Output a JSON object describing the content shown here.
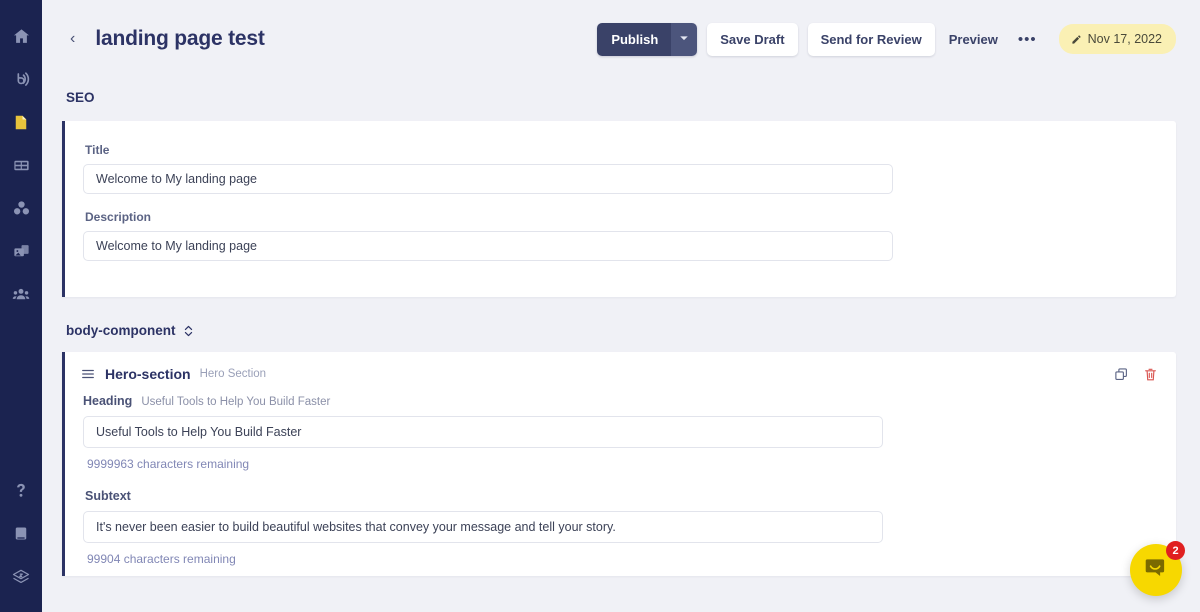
{
  "sidebar": {
    "items": [
      {
        "icon": "home-icon",
        "name": "sidebar-item-home",
        "active": false
      },
      {
        "icon": "broadcast-icon",
        "name": "sidebar-item-broadcast",
        "active": false
      },
      {
        "icon": "page-icon",
        "name": "sidebar-item-pages",
        "active": true
      },
      {
        "icon": "table-icon",
        "name": "sidebar-item-tables",
        "active": false
      },
      {
        "icon": "components-icon",
        "name": "sidebar-item-components",
        "active": false
      },
      {
        "icon": "media-icon",
        "name": "sidebar-item-media",
        "active": false
      },
      {
        "icon": "users-icon",
        "name": "sidebar-item-users",
        "active": false
      }
    ],
    "bottom_items": [
      {
        "icon": "help-icon",
        "name": "sidebar-item-help"
      },
      {
        "icon": "book-icon",
        "name": "sidebar-item-docs"
      },
      {
        "icon": "layers-logo-icon",
        "name": "sidebar-logo"
      }
    ]
  },
  "header": {
    "back_label": "‹",
    "title": "landing page test",
    "publish_label": "Publish",
    "publish_caret_icon": "chevron-down-icon",
    "save_draft_label": "Save Draft",
    "send_for_review_label": "Send for Review",
    "preview_label": "Preview",
    "more_label": "•••",
    "date_pill": {
      "icon": "pencil-icon",
      "label": "Nov 17, 2022",
      "bg_color": "#faf0b4"
    }
  },
  "seo": {
    "section_label": "SEO",
    "title_field": {
      "label": "Title",
      "value": "Welcome to My landing page",
      "placeholder": ""
    },
    "description_field": {
      "label": "Description",
      "value": "Welcome to My landing page",
      "placeholder": ""
    }
  },
  "body_component": {
    "section_label": "body-component",
    "collapse_icon": "chevron-up-down-icon",
    "hero": {
      "drag_icon": "drag-handle-icon",
      "name": "Hero-section",
      "subtitle": "Hero Section",
      "duplicate_icon": "duplicate-icon",
      "delete_icon": "trash-icon",
      "heading_field": {
        "label": "Heading",
        "hint": "Useful Tools to Help You Build Faster",
        "value": "Useful Tools to Help You Build Faster",
        "remaining": "9999963 characters remaining"
      },
      "subtext_field": {
        "label": "Subtext",
        "value": "It's never been easier to build beautiful websites that convey your message and tell your story.",
        "remaining": "99904 characters remaining"
      }
    }
  },
  "chat_widget": {
    "icon": "chat-bubble-icon",
    "badge_count": "2",
    "color": "#f7d800",
    "badge_color": "#e02020"
  },
  "colors": {
    "sidebar_bg": "#1b2350",
    "page_bg": "#f0f1f6",
    "accent_navy": "#2c3365",
    "active_yellow": "#e8c33c",
    "link_blue": "#8187b5",
    "danger_red": "#d9534f"
  }
}
